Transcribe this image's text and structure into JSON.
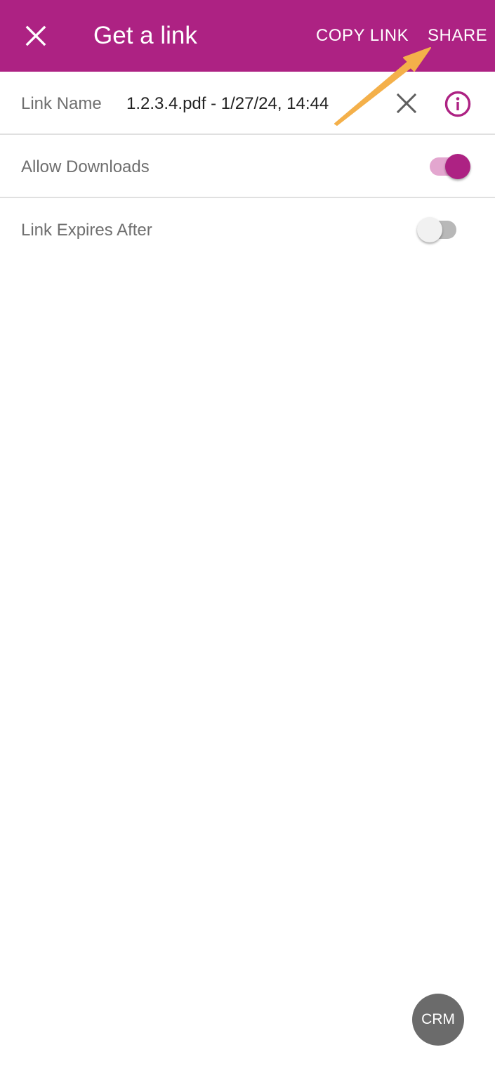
{
  "appbar": {
    "title": "Get a link",
    "copy_link_label": "COPY LINK",
    "share_label": "SHARE",
    "close_icon": "close-icon",
    "background_color": "#ad2283"
  },
  "link_name": {
    "label": "Link Name",
    "value": "1.2.3.4.pdf - 1/27/24, 14:44",
    "clear_icon": "close-icon",
    "info_icon": "info-icon"
  },
  "allow_downloads": {
    "label": "Allow Downloads",
    "enabled": true
  },
  "link_expires": {
    "label": "Link Expires After",
    "enabled": false
  },
  "fab": {
    "label": "CRM",
    "color": "#6b6b6b"
  },
  "annotation": {
    "color": "#f4b04a",
    "target": "share-button"
  }
}
